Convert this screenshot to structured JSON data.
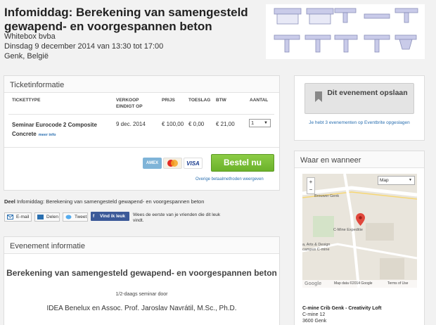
{
  "event": {
    "title": "Infomiddag: Berekening van samengesteld gewapend- en voorgespannen beton",
    "organizer": "Whitebox bvba",
    "date": "Dinsdag 9 december 2014 van 13:30 tot 17:00",
    "location": "Genk, België"
  },
  "tickets": {
    "header": "Ticketinformatie",
    "columns": [
      "TICKETTYPE",
      "VERKOOP EINDIGT OP",
      "PRIJS",
      "TOESLAG",
      "BTW",
      "AANTAL"
    ],
    "rows": [
      {
        "name": "Seminar Eurocode 2 Composite Concrete",
        "more": "meer info",
        "ends": "9 dec. 2014",
        "price": "€ 100,00",
        "fee": "€ 0,00",
        "vat": "€ 21,00",
        "qty": "1"
      }
    ],
    "payment_cards": [
      "AMEX",
      "MasterCard",
      "VISA"
    ],
    "buy_label": "Bestel nu",
    "other_payment": "Overige betaalmethoden weergeven"
  },
  "share": {
    "prefix": "Deel",
    "text": "Infomiddag: Berekening van samengesteld gewapend- en voorgespannen beton",
    "email": "E-mail",
    "share": "Delen",
    "tweet": "Tweet",
    "fb_like": "Vind ik leuk",
    "fb_text": "Wees de eerste van je vrienden die dit leuk vindt."
  },
  "info": {
    "header": "Evenement informatie",
    "title": "Berekening van samengesteld gewapend- en voorgespannen beton",
    "subtitle": "1/2-daags seminar door",
    "authors": "IDEA Benelux en Assoc. Prof. Jaroslav Navrátil, M.Sc., Ph.D."
  },
  "save": {
    "label": "Dit evenement opslaan",
    "saved_text": "Je hebt 3 evenementen op Eventbrite opgeslagen"
  },
  "where": {
    "header": "Waar en wanneer",
    "map_type": "Map",
    "labels": {
      "genk": "Brouwer Genk",
      "poi": "C-Mine Expeditie",
      "campus1": "a, Arts & Design",
      "campus2": "campus C-mine"
    },
    "map_data": "Map data ©2014 Google",
    "terms": "Terms of Use",
    "google": "Google",
    "venue_name": "C-mine Crib Genk - Creativity Loft",
    "venue_street": "C-mine 12",
    "venue_city": "3600 Genk"
  }
}
